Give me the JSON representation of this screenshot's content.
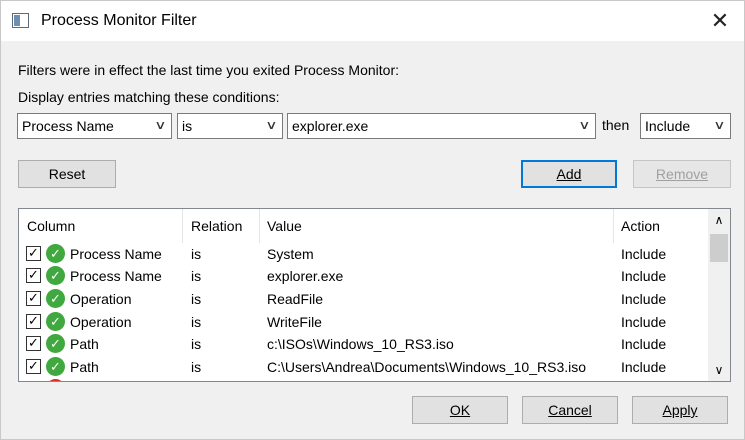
{
  "window": {
    "title": "Process Monitor Filter",
    "close_glyph": "✕",
    "app_icon": "window-icon"
  },
  "intro": {
    "line1": "Filters were in effect the last time you exited Process Monitor:",
    "line2": "Display entries matching these conditions:"
  },
  "condition": {
    "column": "Process Name",
    "relation": "is",
    "value": "explorer.exe",
    "then_label": "then",
    "action": "Include"
  },
  "buttons": {
    "reset": "Reset",
    "add": "Add",
    "remove": "Remove",
    "ok": "OK",
    "cancel": "Cancel",
    "apply": "Apply"
  },
  "list": {
    "headers": {
      "column": "Column",
      "relation": "Relation",
      "value": "Value",
      "action": "Action"
    },
    "rows": [
      {
        "checked": true,
        "icon": "green-check-icon",
        "column": "Process Name",
        "relation": "is",
        "value": "System",
        "action": "Include"
      },
      {
        "checked": true,
        "icon": "green-check-icon",
        "column": "Process Name",
        "relation": "is",
        "value": "explorer.exe",
        "action": "Include"
      },
      {
        "checked": true,
        "icon": "green-check-icon",
        "column": "Operation",
        "relation": "is",
        "value": "ReadFile",
        "action": "Include"
      },
      {
        "checked": true,
        "icon": "green-check-icon",
        "column": "Operation",
        "relation": "is",
        "value": "WriteFile",
        "action": "Include"
      },
      {
        "checked": true,
        "icon": "green-check-icon",
        "column": "Path",
        "relation": "is",
        "value": "c:\\ISOs\\Windows_10_RS3.iso",
        "action": "Include"
      },
      {
        "checked": true,
        "icon": "green-check-icon",
        "column": "Path",
        "relation": "is",
        "value": "C:\\Users\\Andrea\\Documents\\Windows_10_RS3.iso",
        "action": "Include"
      }
    ]
  },
  "colors": {
    "accent": "#0078d7",
    "include_icon": "#3fa83f",
    "exclude_icon": "#d93025"
  }
}
